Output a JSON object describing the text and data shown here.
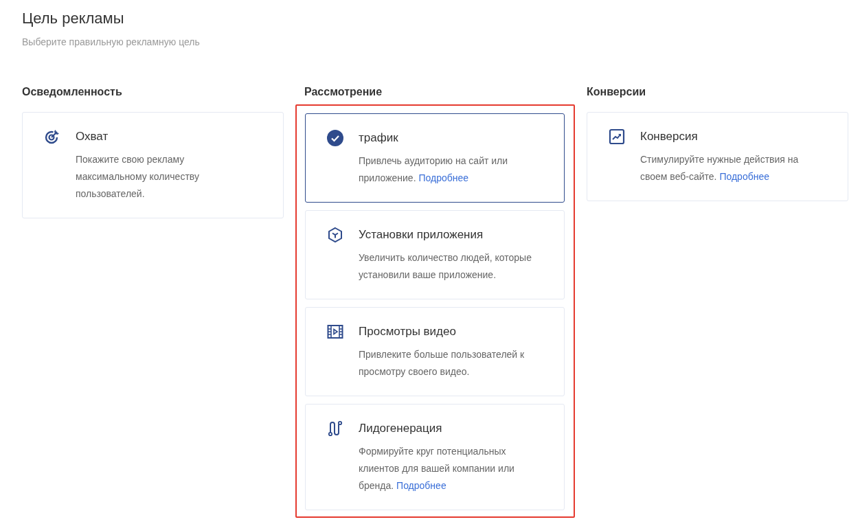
{
  "header": {
    "title": "Цель рекламы",
    "subtitle": "Выберите правильную рекламную цель"
  },
  "columns": [
    {
      "heading": "Осведомленность",
      "highlighted": false,
      "cards": [
        {
          "kind": "target",
          "title": "Охват",
          "description": "Покажите свою рекламу максимальному количеству пользователей.",
          "selected": false
        }
      ]
    },
    {
      "heading": "Рассмотрение",
      "highlighted": true,
      "cards": [
        {
          "kind": "check",
          "title": "трафик",
          "description": "Привлечь аудиторию на сайт или приложение.",
          "link": "Подробнее",
          "selected": true
        },
        {
          "kind": "cube",
          "title": "Установки приложения",
          "description": "Увеличить количество людей, которые установили ваше приложение.",
          "selected": false
        },
        {
          "kind": "film",
          "title": "Просмотры видео",
          "description": "Привлеките больше пользователей к просмотру своего видео.",
          "selected": false
        },
        {
          "kind": "route",
          "title": "Лидогенерация",
          "description": "Формируйте круг потенциальных клиентов для вашей компании или бренда.",
          "link": "Подробнее",
          "selected": false
        }
      ]
    },
    {
      "heading": "Конверсии",
      "highlighted": false,
      "cards": [
        {
          "kind": "chart",
          "title": "Конверсия",
          "description": "Стимулируйте нужные действия на своем веб-сайте.",
          "link": "Подробнее",
          "selected": false
        }
      ]
    }
  ]
}
